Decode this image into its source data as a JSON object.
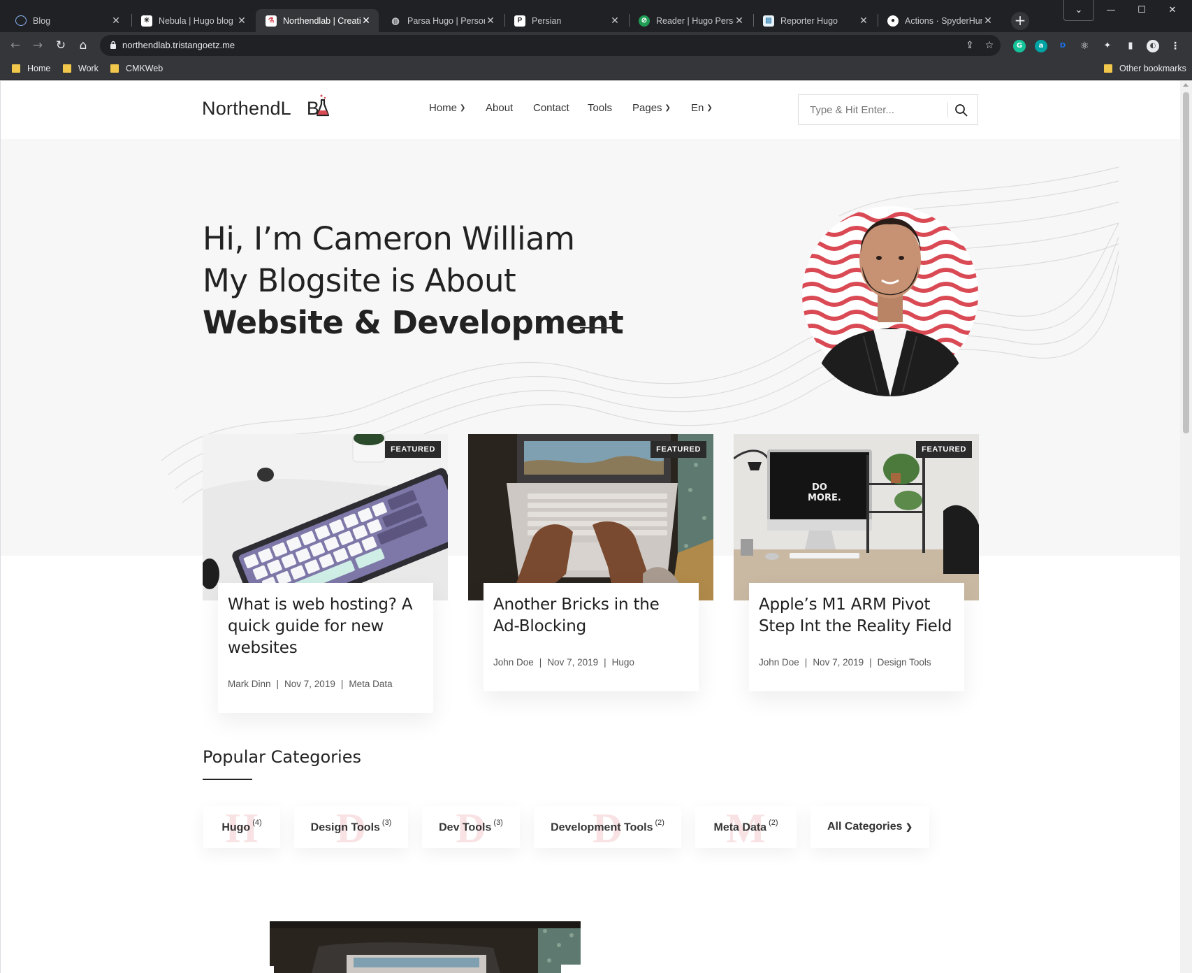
{
  "browser": {
    "tabs": [
      {
        "title": "Blog",
        "active": false
      },
      {
        "title": "Nebula | Hugo blog th",
        "active": false
      },
      {
        "title": "Northendlab | Creativ",
        "active": true
      },
      {
        "title": "Parsa Hugo | Persona",
        "active": false
      },
      {
        "title": "Persian",
        "active": false
      },
      {
        "title": "Reader | Hugo Person",
        "active": false
      },
      {
        "title": "Reporter Hugo",
        "active": false
      },
      {
        "title": "Actions · SpyderHunt",
        "active": false
      }
    ],
    "url": "northendlab.tristangoetz.me",
    "bookmarks": [
      "Home",
      "Work",
      "CMKWeb"
    ],
    "other_bookmarks": "Other bookmarks"
  },
  "site": {
    "logo_text": "NorthendL",
    "logo_tail": "B",
    "nav": [
      {
        "label": "Home",
        "dropdown": true
      },
      {
        "label": "About",
        "dropdown": false
      },
      {
        "label": "Contact",
        "dropdown": false
      },
      {
        "label": "Tools",
        "dropdown": false
      },
      {
        "label": "Pages",
        "dropdown": true
      },
      {
        "label": "En",
        "dropdown": true
      }
    ],
    "search_placeholder": "Type & Hit Enter..."
  },
  "hero": {
    "line1": "Hi, I’m Cameron William",
    "line2": "My Blogsite is About",
    "line3": "Website & Development",
    "accent_color": "#d94a54"
  },
  "posts": [
    {
      "badge": "FEATURED",
      "title": "What is web hosting? A quick guide for new websites",
      "author": "Mark Dinn",
      "date": "Nov 7, 2019",
      "category": "Meta Data"
    },
    {
      "badge": "FEATURED",
      "title": "Another Bricks in the Ad-Blocking",
      "author": "John Doe",
      "date": "Nov 7, 2019",
      "category": "Hugo"
    },
    {
      "badge": "FEATURED",
      "title": "Apple’s M1 ARM Pivot Step Int the Reality Field",
      "author": "John Doe",
      "date": "Nov 7, 2019",
      "category": "Design Tools"
    }
  ],
  "categories": {
    "title": "Popular Categories",
    "items": [
      {
        "label": "Hugo",
        "count": "(4)",
        "ghost": "H"
      },
      {
        "label": "Design Tools",
        "count": "(3)",
        "ghost": "D"
      },
      {
        "label": "Dev Tools",
        "count": "(3)",
        "ghost": "D"
      },
      {
        "label": "Development Tools",
        "count": "(2)",
        "ghost": "D"
      },
      {
        "label": "Meta Data",
        "count": "(2)",
        "ghost": "M"
      }
    ],
    "all_label": "All Categories"
  }
}
